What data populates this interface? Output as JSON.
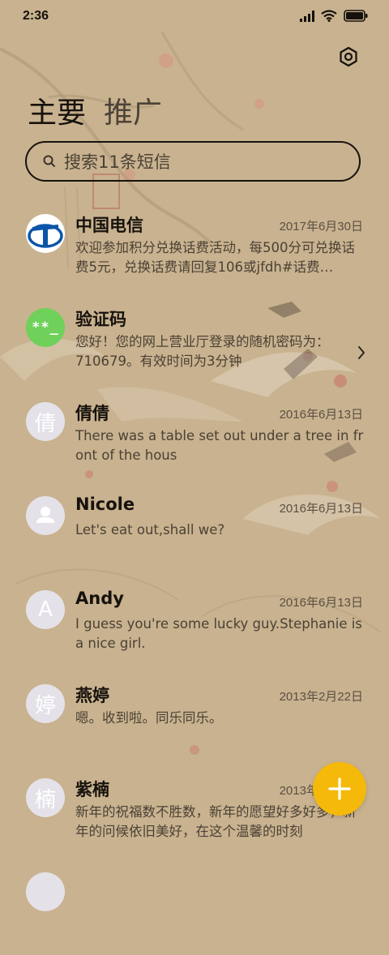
{
  "status_bar": {
    "time": "2:36"
  },
  "tabs": [
    {
      "label": "主要",
      "active": true
    },
    {
      "label": "推广",
      "active": false
    }
  ],
  "search": {
    "placeholder": "搜索11条短信"
  },
  "conversations": [
    {
      "name": "中国电信",
      "date": "2017年6月30日",
      "preview": "欢迎参加积分兑换话费活动，每500分可兑换话费5元，兑换话费请回复106或jfdh#话费…",
      "avatar": "china-telecom-logo"
    },
    {
      "name": "验证码",
      "date": "",
      "preview": "您好！您的网上营业厅登录的随机密码为：710679。有效时间为3分钟",
      "avatar": "verification-code",
      "avatar_text": "**_"
    },
    {
      "name": "倩倩",
      "date": "2016年6月13日",
      "preview": "There was a table set out under a tree in front of the hous",
      "avatar": "letter",
      "avatar_text": "倩"
    },
    {
      "name": "Nicole",
      "date": "2016年6月13日",
      "preview": "Let's eat out,shall we?",
      "avatar": "person"
    },
    {
      "name": "Andy",
      "date": "2016年6月13日",
      "preview": "I guess you're some lucky guy.Stephanie is a nice girl.",
      "avatar": "letter",
      "avatar_text": "A"
    },
    {
      "name": "燕婷",
      "date": "2013年2月22日",
      "preview": "嗯。收到啦。同乐同乐。",
      "avatar": "letter",
      "avatar_text": "婷"
    },
    {
      "name": "紫楠",
      "date": "2013年2月22日",
      "preview": "新年的祝福数不胜数，新年的愿望好多好多，新年的问候依旧美好，在这个温馨的时刻",
      "avatar": "letter",
      "avatar_text": "楠"
    }
  ],
  "colors": {
    "background": "#c9b28f",
    "fab": "#f5b90a",
    "verification_avatar": "#6fd15a",
    "telecom_blue": "#0a55a8"
  }
}
